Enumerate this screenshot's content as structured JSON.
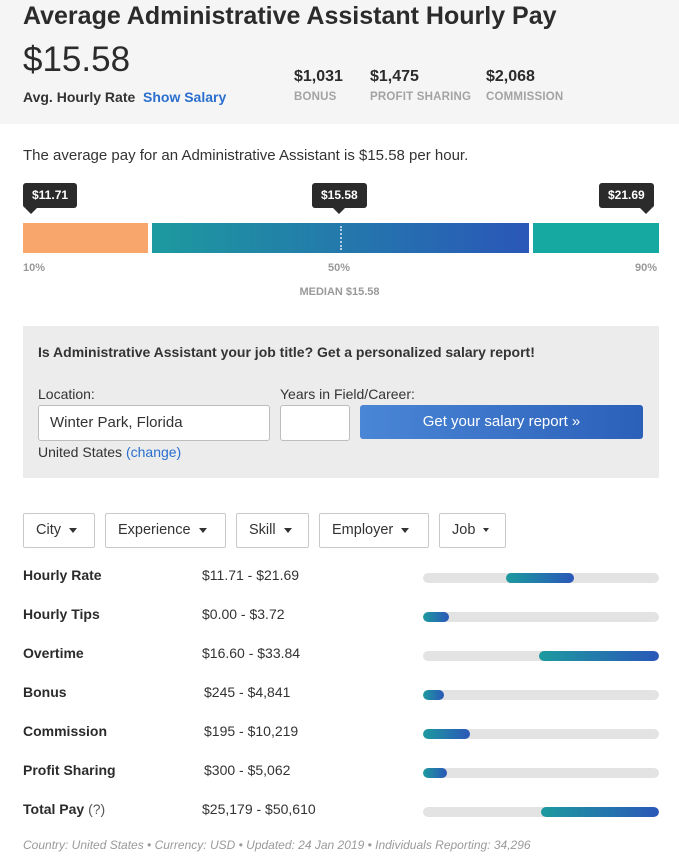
{
  "header": {
    "title": "Average Administrative Assistant Hourly Pay",
    "value": "$15.58",
    "value_label": "Avg. Hourly Rate",
    "show_salary_link": "Show Salary",
    "stats": [
      {
        "amount": "$1,031",
        "label": "BONUS"
      },
      {
        "amount": "$1,475",
        "label": "PROFIT SHARING"
      },
      {
        "amount": "$2,068",
        "label": "COMMISSION"
      }
    ]
  },
  "summary": {
    "text": "The average pay for an Administrative Assistant is $15.58 per hour."
  },
  "distribution": {
    "p10_value": "$11.71",
    "median_value": "$15.58",
    "p90_value": "$21.69",
    "p10_label": "10%",
    "p50_label": "50%",
    "p90_label": "90%",
    "median_label": "MEDIAN $15.58",
    "colors": {
      "low": "#f8a66c",
      "mid_start": "#1d9a9f",
      "mid_end": "#2a57b8",
      "high": "#16a9a2"
    }
  },
  "report_form": {
    "heading": "Is Administrative Assistant your job title? Get a personalized salary report!",
    "location_label": "Location:",
    "location_value": "Winter Park, Florida",
    "country": "United States",
    "change_link": "(change)",
    "years_label": "Years in Field/Career:",
    "years_value": "",
    "button_label": "Get your salary report »"
  },
  "filters": [
    {
      "label": "City"
    },
    {
      "label": "Experience"
    },
    {
      "label": "Skill"
    },
    {
      "label": "Employer"
    },
    {
      "label": "Job"
    }
  ],
  "pay_rows": [
    {
      "label": "Hourly Rate",
      "range": "$11.71 - $21.69",
      "bar_start": 0.35,
      "bar_end": 0.64
    },
    {
      "label": "Hourly Tips",
      "range": "$0.00 - $3.72",
      "bar_start": 0.0,
      "bar_end": 0.11
    },
    {
      "label": "Overtime",
      "range": "$16.60 - $33.84",
      "bar_start": 0.49,
      "bar_end": 1.0
    },
    {
      "label": "Bonus",
      "range": "$245 - $4,841",
      "bar_start": 0.0,
      "bar_end": 0.09
    },
    {
      "label": "Commission",
      "range": "$195 - $10,219",
      "bar_start": 0.0,
      "bar_end": 0.2
    },
    {
      "label": "Profit Sharing",
      "range": "$300 - $5,062",
      "bar_start": 0.0,
      "bar_end": 0.1
    },
    {
      "label": "Total Pay",
      "help": "(?)",
      "range": "$25,179 - $50,610",
      "bar_start": 0.5,
      "bar_end": 1.0
    }
  ],
  "footer": {
    "text": "Country: United States  •  Currency: USD  •  Updated: 24 Jan 2019  •  Individuals Reporting: 34,296"
  }
}
